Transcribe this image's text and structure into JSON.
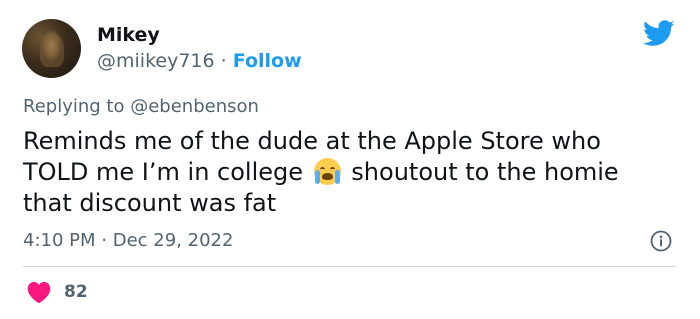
{
  "author": {
    "name": "Mikey",
    "handle": "@miikey716",
    "separator": "·",
    "follow_label": "Follow"
  },
  "reply": {
    "prefix": "Replying to",
    "mention": "@ebenbenson"
  },
  "tweet": {
    "line1": "Reminds me of the dude at the Apple Store who",
    "line2_before_emoji": "TOLD me I’m in college",
    "emoji": "loudly-crying-face",
    "line2_after_emoji": "shoutout to the homie",
    "line3": "that discount was fat"
  },
  "meta": {
    "time": "4:10 PM",
    "separator": "·",
    "date": "Dec 29, 2022"
  },
  "engagement": {
    "likes": "82"
  },
  "icons": {
    "brand": "twitter-bird-icon",
    "info": "info-icon",
    "like": "heart-icon"
  },
  "colors": {
    "brand_blue": "#1d9bf0",
    "like_red": "#f91880",
    "secondary_text": "#536471"
  }
}
